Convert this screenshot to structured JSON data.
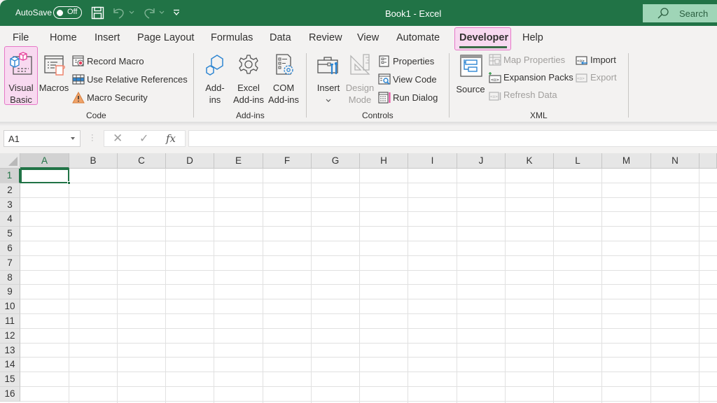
{
  "titlebar": {
    "autosave_label": "AutoSave",
    "autosave_state": "Off",
    "title": "Book1  -  Excel",
    "search_label": "Search",
    "accent_color": "#217346"
  },
  "tabs": [
    {
      "label": "File"
    },
    {
      "label": "Home"
    },
    {
      "label": "Insert"
    },
    {
      "label": "Page Layout"
    },
    {
      "label": "Formulas"
    },
    {
      "label": "Data"
    },
    {
      "label": "Review"
    },
    {
      "label": "View"
    },
    {
      "label": "Automate"
    },
    {
      "label": "Developer",
      "active": true
    },
    {
      "label": "Help"
    }
  ],
  "ribbon": {
    "code": {
      "label": "Code",
      "visual_basic_line1": "Visual",
      "visual_basic_line2": "Basic",
      "macros": "Macros",
      "record_macro": "Record Macro",
      "use_relative_references": "Use Relative References",
      "macro_security": "Macro Security"
    },
    "addins": {
      "label": "Add-ins",
      "addins_line1": "Add-",
      "addins_line2": "ins",
      "excel_addins_line1": "Excel",
      "excel_addins_line2": "Add-ins",
      "com_addins_line1": "COM",
      "com_addins_line2": "Add-ins"
    },
    "controls": {
      "label": "Controls",
      "insert": "Insert",
      "design_mode_line1": "Design",
      "design_mode_line2": "Mode",
      "properties": "Properties",
      "view_code": "View Code",
      "run_dialog": "Run Dialog"
    },
    "xml": {
      "label": "XML",
      "source": "Source",
      "map_properties": "Map Properties",
      "expansion_packs": "Expansion Packs",
      "refresh_data": "Refresh Data",
      "import": "Import",
      "export": "Export"
    }
  },
  "formula_bar": {
    "name_box": "A1",
    "cancel_symbol": "✕",
    "enter_symbol": "✓",
    "fx_label": "fx",
    "formula_value": ""
  },
  "sheet": {
    "columns": [
      "A",
      "B",
      "C",
      "D",
      "E",
      "F",
      "G",
      "H",
      "I",
      "J",
      "K",
      "L",
      "M",
      "N"
    ],
    "rows": [
      "1",
      "2",
      "3",
      "4",
      "5",
      "6",
      "7",
      "8",
      "9",
      "10",
      "11",
      "12",
      "13",
      "14",
      "15",
      "16"
    ],
    "active_cell": "A1"
  }
}
